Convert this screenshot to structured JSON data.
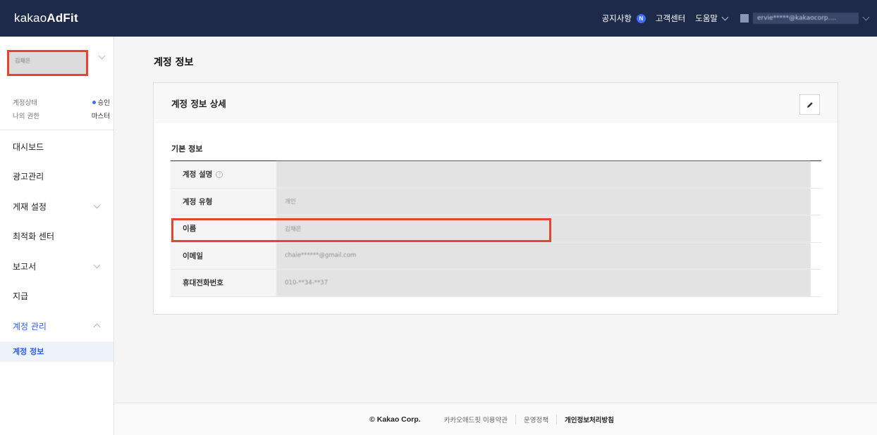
{
  "header": {
    "logo_light": "kakao",
    "logo_bold": "AdFit",
    "notice_label": "공지사항",
    "notice_badge": "N",
    "support_label": "고객센터",
    "help_label": "도움말",
    "user_email": "ervie*****@kakaocorp...."
  },
  "sidebar": {
    "account_name": "김채은",
    "status_label": "계정상태",
    "status_value": "승인",
    "role_label": "나의 권한",
    "role_value": "마스터",
    "items": [
      {
        "label": "대시보드"
      },
      {
        "label": "광고관리"
      },
      {
        "label": "게재 설정"
      },
      {
        "label": "최적화 센터"
      },
      {
        "label": "보고서"
      },
      {
        "label": "지급"
      },
      {
        "label": "계정 관리"
      }
    ],
    "sub_item": "계정 정보"
  },
  "main": {
    "page_title": "계정 정보",
    "card_title": "계정 정보 상세",
    "section_title": "기본 정보",
    "rows": [
      {
        "label": "계정 설명",
        "value": ""
      },
      {
        "label": "계정 유형",
        "value": "개인"
      },
      {
        "label": "이름",
        "value": "김채은"
      },
      {
        "label": "이메일",
        "value": "chaie******@gmail.com"
      },
      {
        "label": "휴대전화번호",
        "value": "010-**34-**37"
      }
    ]
  },
  "footer": {
    "copyright": "© Kakao Corp.",
    "terms": "카카오애드핏 이용약관",
    "policy": "운영정책",
    "privacy": "개인정보처리방침"
  },
  "colors": {
    "topbar": "#1e2a4a",
    "accent": "#2c5dff",
    "highlight": "#e8442d"
  }
}
